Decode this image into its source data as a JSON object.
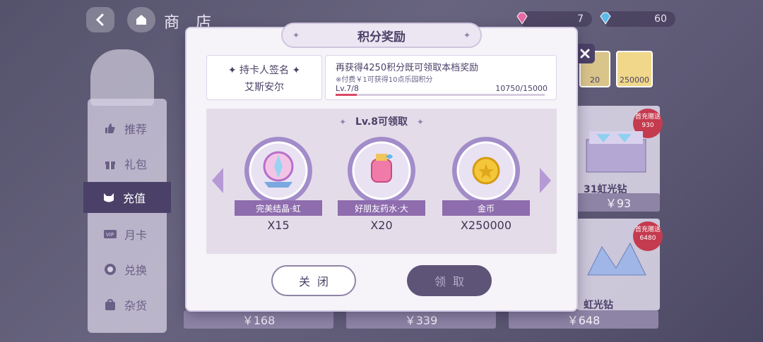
{
  "header": {
    "title": "商 店",
    "currencies": [
      {
        "name": "pink-gem",
        "value": "7",
        "color": "#e56aa6"
      },
      {
        "name": "blue-gem",
        "value": "60",
        "color": "#5db9e8"
      }
    ]
  },
  "sidebar": {
    "items": [
      {
        "label": "推荐",
        "icon": "thumbs-up-icon"
      },
      {
        "label": "礼包",
        "icon": "gift-icon"
      },
      {
        "label": "充值",
        "icon": "cat-icon",
        "active": true
      },
      {
        "label": "月卡",
        "icon": "vip-card-icon"
      },
      {
        "label": "兑换",
        "icon": "exchange-icon"
      },
      {
        "label": "杂货",
        "icon": "bag-icon"
      }
    ]
  },
  "store": {
    "top_strip": [
      {
        "label": "20"
      },
      {
        "label": "250000"
      }
    ],
    "cards": [
      {
        "badge": "首充赠送 930",
        "name": "31虹光钻",
        "price": "￥93"
      },
      {
        "badge": "首充赠送 6480",
        "name": "虹光钻",
        "price": "￥648"
      }
    ],
    "bottom_prices": [
      "￥168",
      "￥339",
      "￥648"
    ]
  },
  "modal": {
    "title": "积分奖励",
    "signature": {
      "label": "✦ 持卡人签名 ✦",
      "name": "艾斯安尔"
    },
    "info": {
      "message": "再获得4250积分既可领取本档奖励",
      "note": "※付费￥1可获得10点乐园积分",
      "level": "Lv.7/8",
      "points": "10750/15000",
      "progress": 0.1
    },
    "reward_title": "Lv.8可领取",
    "rewards": [
      {
        "name": "完美结晶·虹",
        "qty": "X15",
        "icon": "crystal-orb-icon"
      },
      {
        "name": "好朋友药水·大",
        "qty": "X20",
        "icon": "potion-icon"
      },
      {
        "name": "金币",
        "qty": "X250000",
        "icon": "gold-coin-icon"
      }
    ],
    "buttons": {
      "close": "关闭",
      "claim": "领取"
    }
  }
}
